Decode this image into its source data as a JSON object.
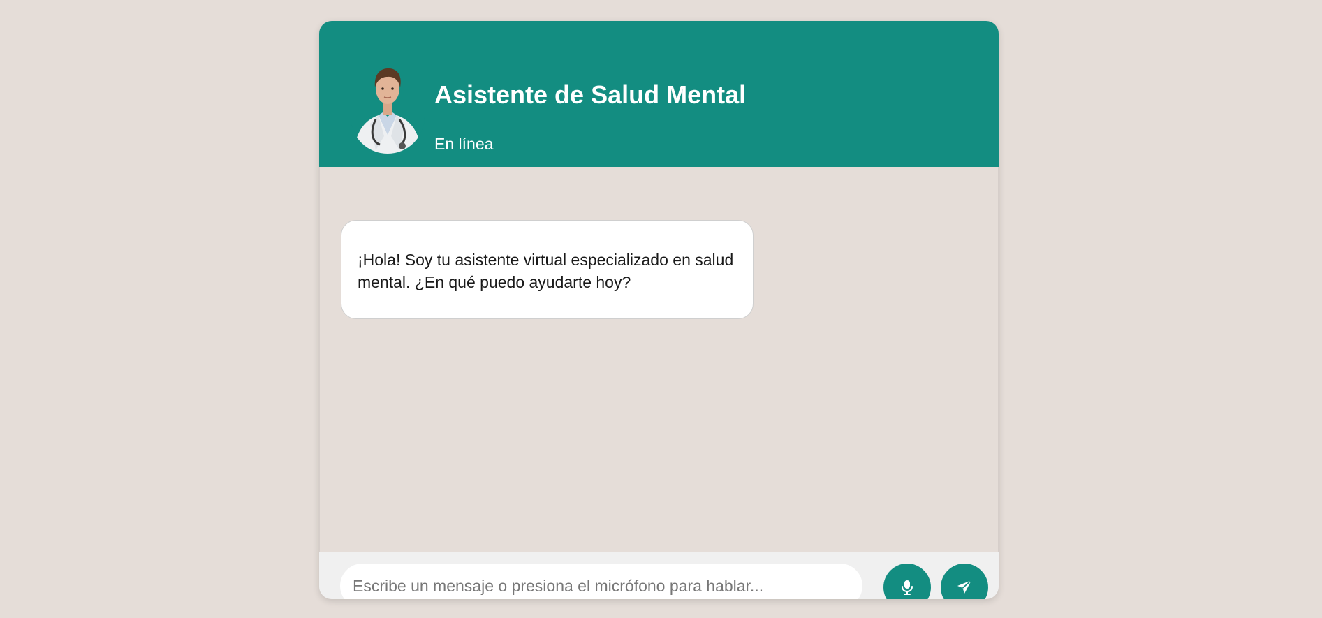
{
  "header": {
    "title": "Asistente de Salud Mental",
    "status": "En línea",
    "avatar_icon": "doctor-avatar"
  },
  "messages": [
    {
      "sender": "bot",
      "text": "¡Hola! Soy tu asistente virtual especializado en salud mental. ¿En qué puedo ayudarte hoy?"
    }
  ],
  "input": {
    "value": "",
    "placeholder": "Escribe un mensaje o presiona el micrófono para hablar..."
  },
  "buttons": {
    "mic_icon": "microphone-icon",
    "send_icon": "send-icon"
  },
  "colors": {
    "accent": "#138d81",
    "background": "#e5ddd8",
    "bubble": "#ffffff",
    "input_bar": "#f0f0f0"
  }
}
